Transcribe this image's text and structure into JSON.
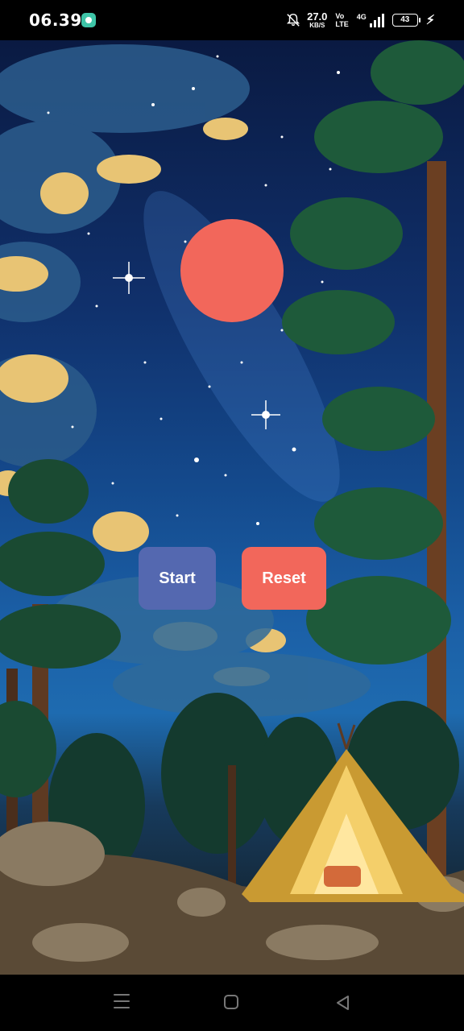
{
  "status_bar": {
    "time": "06.39",
    "net_speed_value": "27.0",
    "net_speed_unit": "KB/S",
    "volte_top": "Vo",
    "volte_bottom": "LTE",
    "network_type": "4G",
    "battery_level": "43",
    "icons": [
      "app-notification-icon",
      "mute-icon",
      "signal-icon",
      "battery-icon",
      "charging-icon"
    ]
  },
  "main": {
    "indicator_circle_color": "#f2675b",
    "start_label": "Start",
    "reset_label": "Reset",
    "colors": {
      "start": "#5468b0",
      "reset": "#f2675b"
    }
  },
  "nav_bar": {
    "icons": [
      "recent-apps-icon",
      "home-icon",
      "back-icon"
    ]
  }
}
